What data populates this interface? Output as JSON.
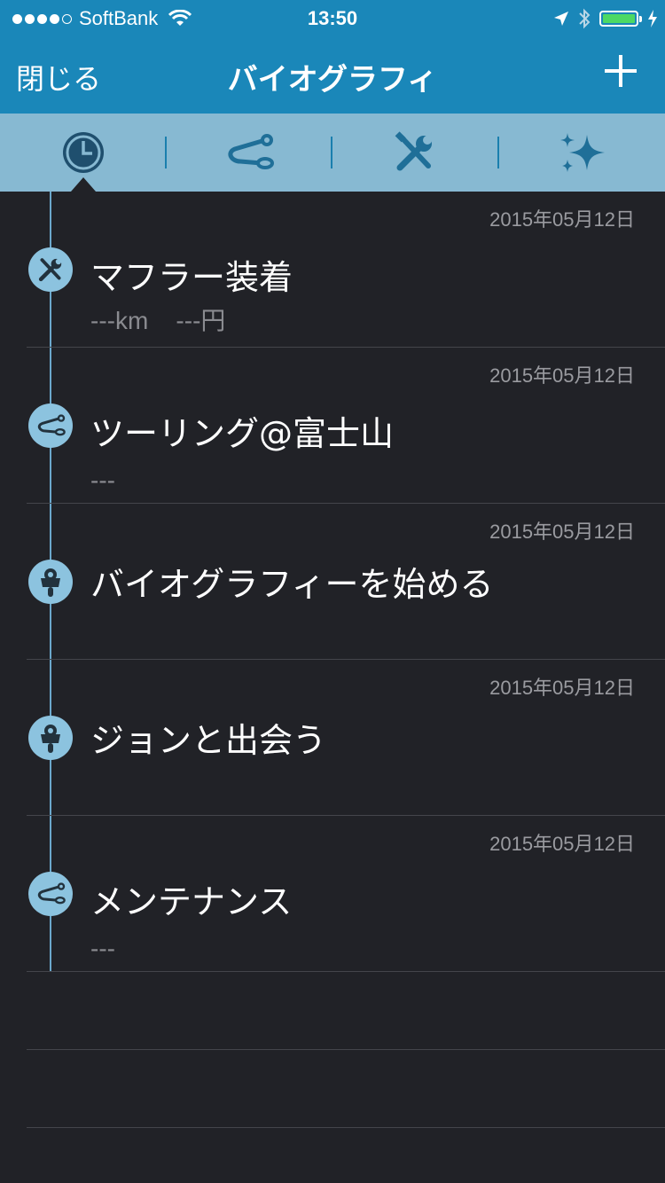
{
  "status_bar": {
    "carrier": "SoftBank",
    "time": "13:50",
    "signal_bars": 4,
    "battery_level": 1.0
  },
  "nav": {
    "close_label": "閉じる",
    "title": "バイオグラフィ",
    "add_icon": "plus-icon"
  },
  "tabs": [
    {
      "icon": "clock-icon",
      "selected": true
    },
    {
      "icon": "route-icon",
      "selected": false
    },
    {
      "icon": "tools-icon",
      "selected": false
    },
    {
      "icon": "sparkle-icon",
      "selected": false
    }
  ],
  "entries": [
    {
      "date": "2015年05月12日",
      "icon": "tools-icon",
      "title": "マフラー装着",
      "sub": "---km    ---円"
    },
    {
      "date": "2015年05月12日",
      "icon": "route-icon",
      "title": "ツーリング@富士山",
      "sub": "---"
    },
    {
      "date": "2015年05月12日",
      "icon": "motorcycle-icon",
      "title": "バイオグラフィーを始める",
      "sub": ""
    },
    {
      "date": "2015年05月12日",
      "icon": "motorcycle-icon",
      "title": "ジョンと出会う",
      "sub": ""
    },
    {
      "date": "2015年05月12日",
      "icon": "route-icon",
      "title": "メンテナンス",
      "sub": "---"
    }
  ],
  "colors": {
    "bar": "#1a87b9",
    "tabbar": "#87b9d2",
    "background": "#212227",
    "badge": "#8cc3df",
    "icon_dark": "#1f4f6e"
  }
}
